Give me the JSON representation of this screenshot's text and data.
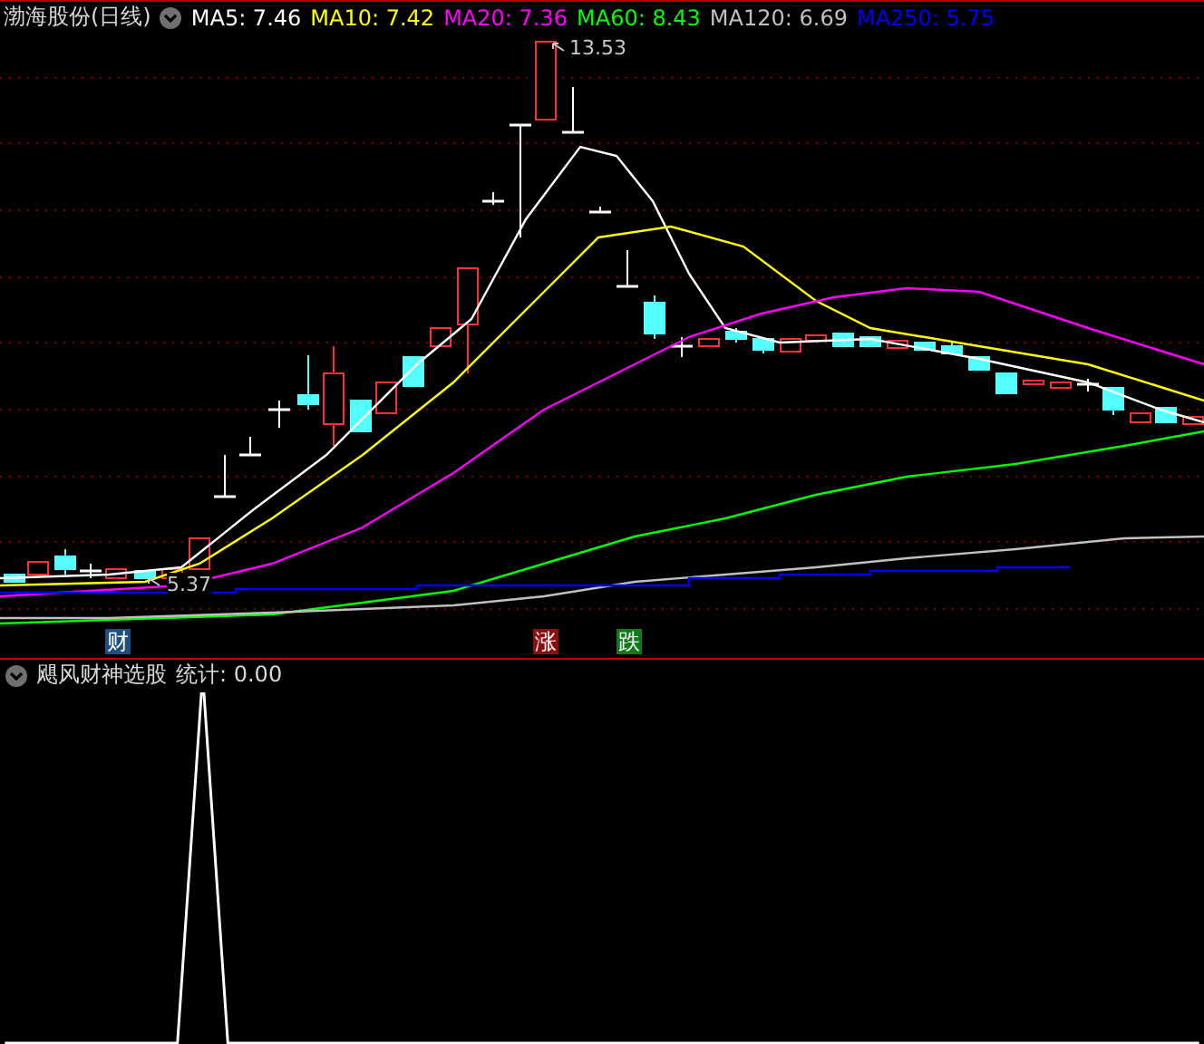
{
  "header": {
    "title": "渤海股份(日线)",
    "ma_legend": [
      {
        "label": "MA5: 7.46",
        "color": "#ffffff"
      },
      {
        "label": "MA10: 7.42",
        "color": "#ffff00"
      },
      {
        "label": "MA20: 7.36",
        "color": "#ff00ff"
      },
      {
        "label": "MA60: 8.43",
        "color": "#00ff00"
      },
      {
        "label": "MA120: 6.69",
        "color": "#c0c0c0"
      },
      {
        "label": "MA250: 5.75",
        "color": "#0000ff"
      }
    ]
  },
  "price_labels": {
    "high": "13.53",
    "low": "5.37"
  },
  "signal_markers": [
    {
      "text": "财",
      "color": "#1f4f80"
    },
    {
      "text": "涨",
      "color": "#8a1010"
    },
    {
      "text": "跌",
      "color": "#0f7a1a"
    }
  ],
  "indicator": {
    "title": "飓风财神选股",
    "stat": "统计: 0.00"
  }
}
